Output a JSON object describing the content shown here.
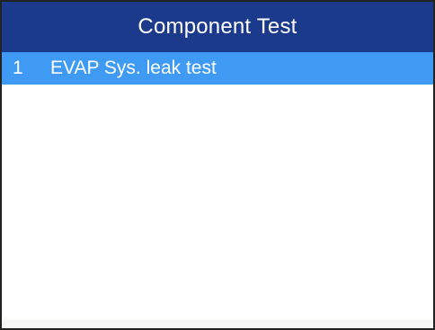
{
  "header": {
    "title": "Component Test"
  },
  "menu": {
    "items": [
      {
        "number": "1",
        "label": "EVAP Sys. leak test",
        "selected": true
      }
    ]
  },
  "colors": {
    "title_bar": "#1b3a8c",
    "selected_row": "#3f9af4",
    "text_light": "#ffffff",
    "background": "#ffffff"
  }
}
